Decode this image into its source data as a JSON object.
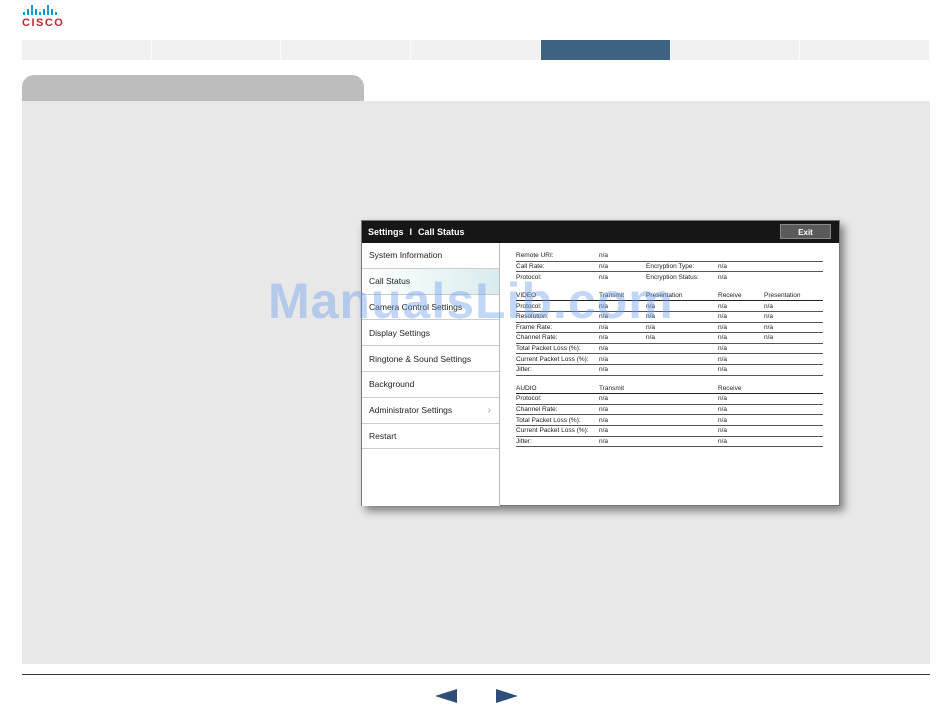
{
  "logo": {
    "text": "CISCO",
    "color": "#c0282d",
    "bar_color": "#049fd9"
  },
  "topnav": {
    "tab_count": 7,
    "active_index": 4,
    "active_color": "#3e6281"
  },
  "device": {
    "header_title": "Settings",
    "header_separator": "I",
    "header_subtitle": "Call Status",
    "exit_label": "Exit",
    "menu": [
      {
        "label": "System Information",
        "chevron": ""
      },
      {
        "label": "Call Status",
        "chevron": ""
      },
      {
        "label": "Camera Control Settings",
        "chevron": ""
      },
      {
        "label": "Display Settings",
        "chevron": ""
      },
      {
        "label": "Ringtone & Sound Settings",
        "chevron": ""
      },
      {
        "label": "Background",
        "chevron": ""
      },
      {
        "label": "Administrator Settings",
        "chevron": "›"
      },
      {
        "label": "Restart",
        "chevron": ""
      }
    ],
    "general": [
      {
        "label": "Remote URI:",
        "value": "n/a",
        "label2": "",
        "value2": ""
      },
      {
        "label": "Call Rate:",
        "value": "n/a",
        "label2": "Encryption Type:",
        "value2": "n/a"
      },
      {
        "label": "Protocol:",
        "value": "n/a",
        "label2": "Encryption Status:",
        "value2": "n/a"
      }
    ],
    "video": {
      "headers": [
        "VIDEO",
        "Transmit",
        "Presentation",
        "Receive",
        "Presentation"
      ],
      "rows": [
        [
          "Protocol:",
          "n/a",
          "n/a",
          "n/a",
          "n/a"
        ],
        [
          "Resolution:",
          "n/a",
          "n/a",
          "n/a",
          "n/a"
        ],
        [
          "Frame Rate:",
          "n/a",
          "n/a",
          "n/a",
          "n/a"
        ],
        [
          "Channel Rate:",
          "n/a",
          "n/a",
          "n/a",
          "n/a"
        ],
        [
          "Total Packet Loss (%):",
          "n/a",
          "",
          "n/a",
          ""
        ],
        [
          "Current Packet Loss (%):",
          "n/a",
          "",
          "n/a",
          ""
        ],
        [
          "Jitter:",
          "n/a",
          "",
          "n/a",
          ""
        ]
      ]
    },
    "audio": {
      "headers": [
        "AUDIO",
        "Transmit",
        "Receive"
      ],
      "rows": [
        [
          "Protocol:",
          "n/a",
          "n/a"
        ],
        [
          "Channel Rate:",
          "n/a",
          "n/a"
        ],
        [
          "Total Packet Loss (%):",
          "n/a",
          "n/a"
        ],
        [
          "Current Packet Loss (%):",
          "n/a",
          "n/a"
        ],
        [
          "Jitter:",
          "n/a",
          "n/a"
        ]
      ]
    }
  },
  "watermark": {
    "text": "ManualsLib.com"
  },
  "footer": {
    "prev_icon": "triangle-left-icon",
    "next_icon": "triangle-right-icon"
  }
}
